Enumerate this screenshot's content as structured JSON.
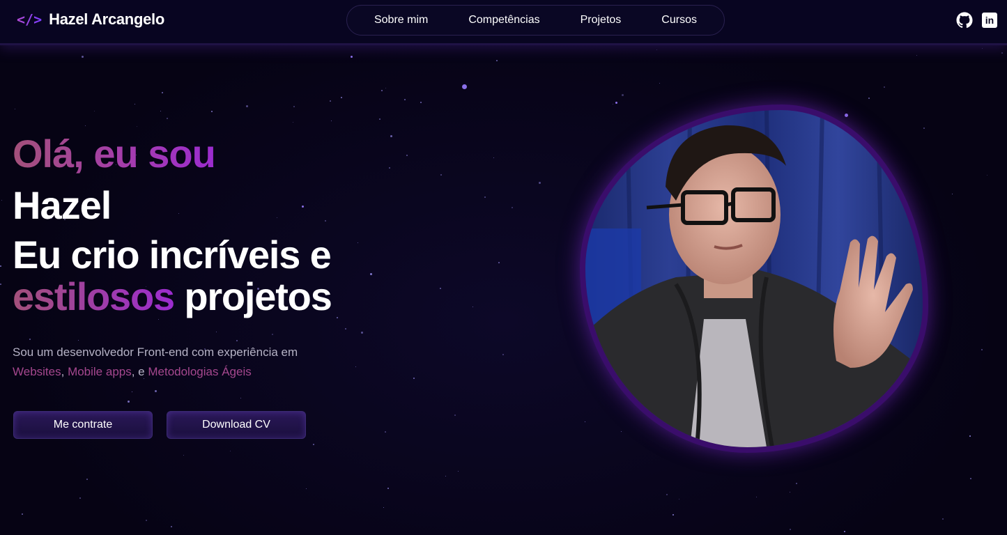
{
  "brand": {
    "logo": "</>",
    "name": "Hazel Arcangelo"
  },
  "nav": {
    "items": [
      {
        "label": "Sobre mim"
      },
      {
        "label": "Competências"
      },
      {
        "label": "Projetos"
      },
      {
        "label": "Cursos"
      }
    ]
  },
  "social": {
    "github_icon": "github-icon",
    "linkedin_icon": "linkedin-icon",
    "linkedin_text": "in"
  },
  "hero": {
    "greeting": "Olá, eu sou",
    "name": "Hazel",
    "tagline_line1": "Eu crio incríveis e",
    "tagline_highlight": "estilosos",
    "tagline_rest": " projetos",
    "desc_line1": "Sou um desenvolvedor Front-end com experiência em",
    "desc_hl1": "Websites",
    "desc_sep1": ", ",
    "desc_hl2": "Mobile apps",
    "desc_sep2": ", e ",
    "desc_hl3": "Metodologias Ágeis"
  },
  "buttons": {
    "hire": "Me contrate",
    "download": "Download CV"
  },
  "colors": {
    "background": "#07041a",
    "accent_purple": "#9b2ccf",
    "accent_pink": "#a3507a",
    "highlight_text": "#a5478e"
  }
}
